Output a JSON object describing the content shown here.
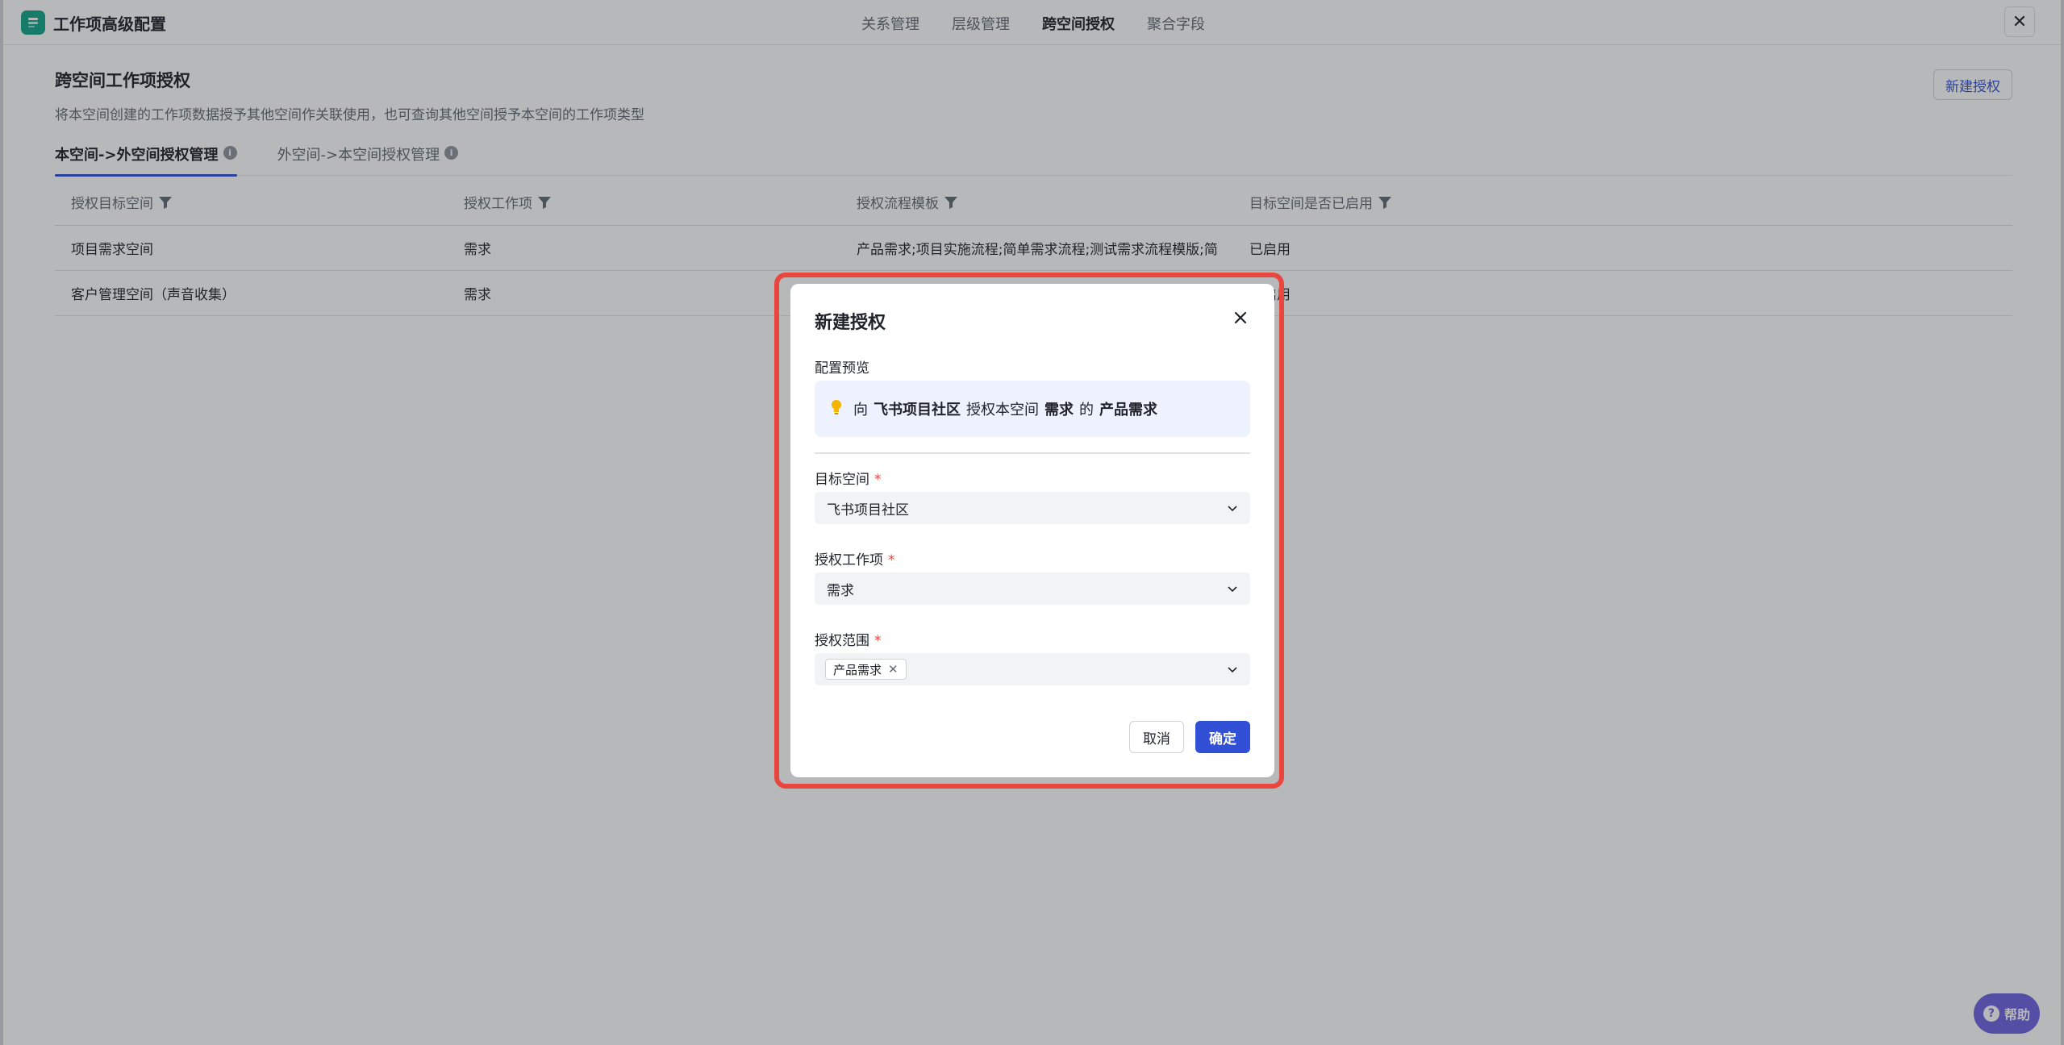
{
  "header": {
    "app_title": "工作项高级配置",
    "tabs": [
      {
        "label": "关系管理"
      },
      {
        "label": "层级管理"
      },
      {
        "label": "跨空间授权"
      },
      {
        "label": "聚合字段"
      }
    ],
    "active_tab": "跨空间授权",
    "close_glyph": "✕"
  },
  "section": {
    "title": "跨空间工作项授权",
    "description": "将本空间创建的工作项数据授予其他空间作关联使用，也可查询其他空间授予本空间的工作项类型",
    "new_button": "新建授权"
  },
  "sub_tabs": [
    {
      "label": "本空间->外空间授权管理"
    },
    {
      "label": "外空间->本空间授权管理"
    }
  ],
  "table": {
    "columns": [
      "授权目标空间",
      "授权工作项",
      "授权流程模板",
      "目标空间是否已启用"
    ],
    "rows": [
      [
        "项目需求空间",
        "需求",
        "产品需求;项目实施流程;简单需求流程;测试需求流程模版;简",
        "已启用"
      ],
      [
        "客户管理空间（声音收集）",
        "需求",
        "",
        "已启用"
      ]
    ]
  },
  "modal": {
    "title": "新建授权",
    "close_glyph": "✕",
    "preview_label": "配置预览",
    "preview": {
      "p1": "向",
      "space": "飞书项目社区",
      "p2": "授权本空间",
      "item": "需求",
      "p3": "的",
      "template": "产品需求"
    },
    "target_space": {
      "label": "目标空间",
      "value": "飞书项目社区"
    },
    "work_item": {
      "label": "授权工作项",
      "value": "需求"
    },
    "scope": {
      "label": "授权范围",
      "tags": [
        "产品需求"
      ]
    },
    "required_mark": "*",
    "cancel": "取消",
    "confirm": "确定"
  },
  "help": {
    "label": "帮助",
    "glyph": "?"
  },
  "colors": {
    "accent": "#3250d6",
    "highlight": "#e8463f",
    "logo": "#14a58a",
    "help": "#6f63e0"
  }
}
